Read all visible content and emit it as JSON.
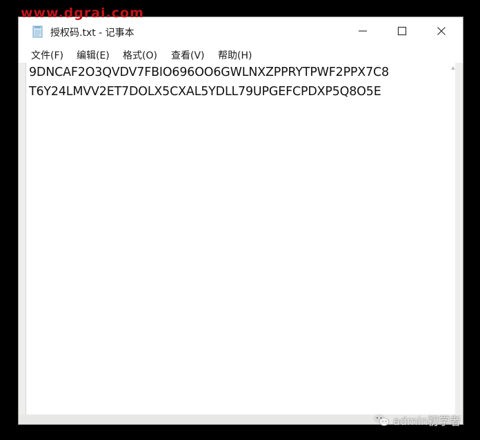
{
  "watermark_top": "www.dgrai.com",
  "window": {
    "title": "授权码.txt - 记事本",
    "controls": {
      "minimize_glyph": "—",
      "maximize_glyph": "☐",
      "close_glyph": "✕"
    }
  },
  "menu": {
    "items": [
      {
        "label": "文件(F)"
      },
      {
        "label": "编辑(E)"
      },
      {
        "label": "格式(O)"
      },
      {
        "label": "查看(V)"
      },
      {
        "label": "帮助(H)"
      }
    ]
  },
  "editor": {
    "lines": [
      "9DNCAF2O3QVDV7FBIO696OO6GWLNXZPPRYTPWF2PPX7C8",
      "T6Y24LMVV2ET7DOLX5CXAL5YDLL79UPGEFCPDXP5Q8O5E"
    ]
  },
  "watermark_bottom": {
    "text": "admin初学者",
    "icon": "wechat-icon"
  },
  "colors": {
    "watermark_red": "#c0141c",
    "background": "#000000",
    "editor_bg": "#ffffff"
  }
}
